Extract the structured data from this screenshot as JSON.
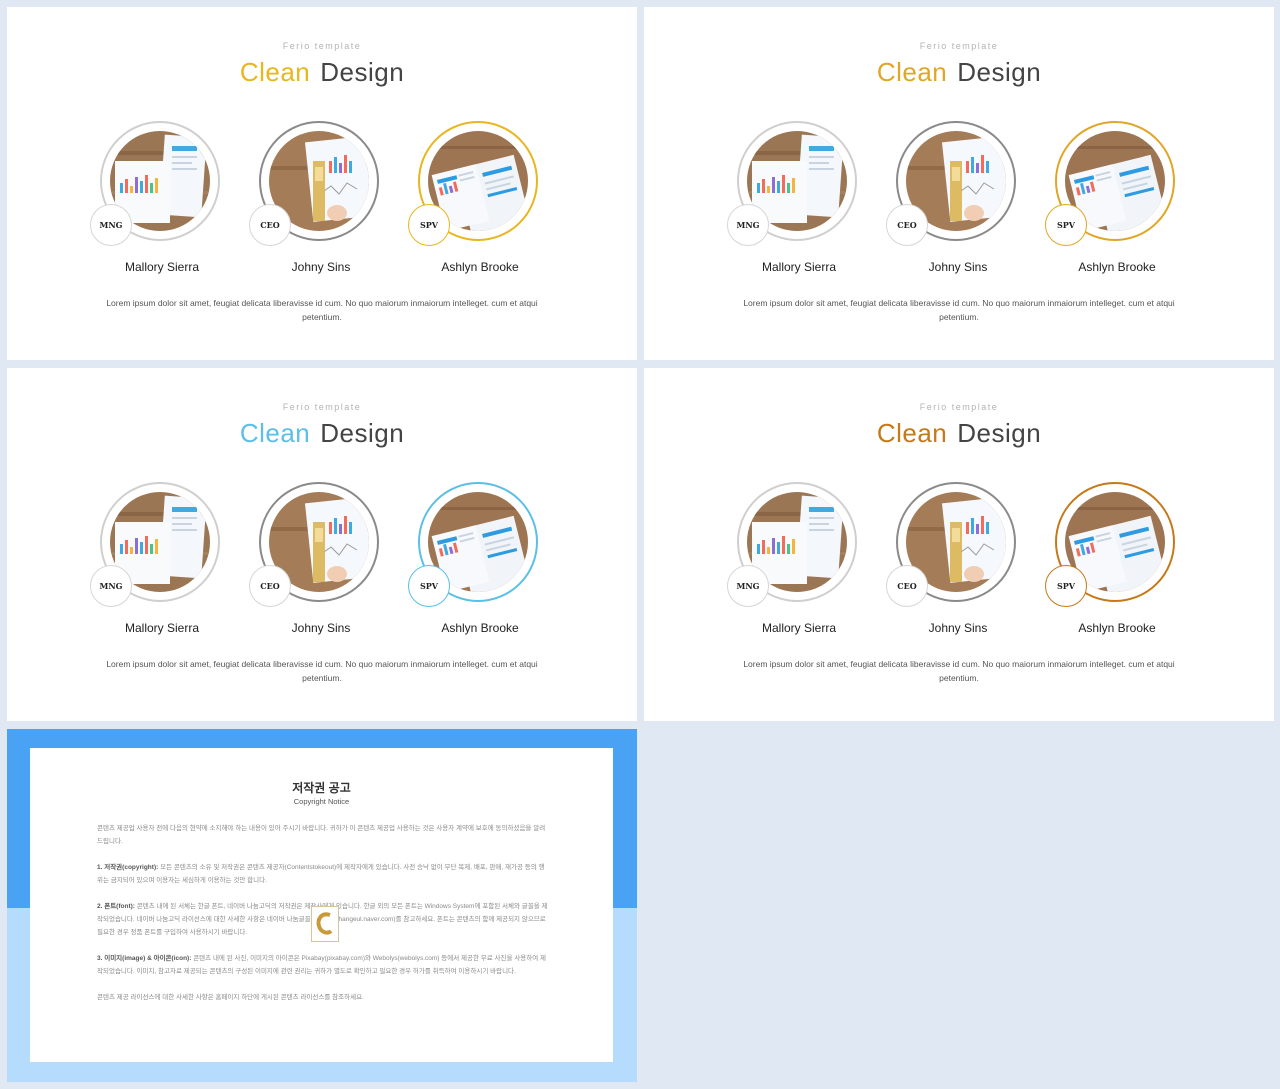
{
  "slides": [
    {
      "subtitle": "Ferio template",
      "title_accent": "Clean",
      "title_rest": "Design",
      "accent_color": "#e8b61e",
      "members": [
        {
          "role": "MNG",
          "name": "Mallory Sierra",
          "ring_color": "#cfcfcf"
        },
        {
          "role": "CEO",
          "name": "Johny Sins",
          "ring_color": "#8a8a8a"
        },
        {
          "role": "SPV",
          "name": "Ashlyn Brooke",
          "ring_color": "#e8b61e"
        }
      ],
      "description": "Lorem ipsum dolor sit amet, feugiat delicata liberavisse id cum. No quo maiorum inmaiorum intelleget. cum et atqui petentium."
    },
    {
      "subtitle": "Ferio template",
      "title_accent": "Clean",
      "title_rest": "Design",
      "accent_color": "#e0a626",
      "members": [
        {
          "role": "MNG",
          "name": "Mallory Sierra",
          "ring_color": "#cfcfcf"
        },
        {
          "role": "CEO",
          "name": "Johny Sins",
          "ring_color": "#8a8a8a"
        },
        {
          "role": "SPV",
          "name": "Ashlyn Brooke",
          "ring_color": "#e0a626"
        }
      ],
      "description": "Lorem ipsum dolor sit amet, feugiat delicata liberavisse id cum. No quo maiorum inmaiorum intelleget. cum et atqui petentium."
    },
    {
      "subtitle": "Ferio template",
      "title_accent": "Clean",
      "title_rest": "Design",
      "accent_color": "#5bbfe8",
      "members": [
        {
          "role": "MNG",
          "name": "Mallory Sierra",
          "ring_color": "#cfcfcf"
        },
        {
          "role": "CEO",
          "name": "Johny Sins",
          "ring_color": "#8a8a8a"
        },
        {
          "role": "SPV",
          "name": "Ashlyn Brooke",
          "ring_color": "#5bbfe8"
        }
      ],
      "description": "Lorem ipsum dolor sit amet, feugiat delicata liberavisse id cum. No quo maiorum inmaiorum intelleget. cum et atqui petentium."
    },
    {
      "subtitle": "Ferio template",
      "title_accent": "Clean",
      "title_rest": "Design",
      "accent_color": "#c57a17",
      "members": [
        {
          "role": "MNG",
          "name": "Mallory Sierra",
          "ring_color": "#cfcfcf"
        },
        {
          "role": "CEO",
          "name": "Johny Sins",
          "ring_color": "#8a8a8a"
        },
        {
          "role": "SPV",
          "name": "Ashlyn Brooke",
          "ring_color": "#c57a17"
        }
      ],
      "description": "Lorem ipsum dolor sit amet, feugiat delicata liberavisse id cum. No quo maiorum inmaiorum intelleget. cum et atqui petentium."
    }
  ],
  "notice": {
    "title": "저작권 공고",
    "subtitle": "Copyright Notice",
    "intro": "콘텐츠 제공업 사용자 전에 다음의 현약에 소지해야 하는 내용이 있어 주시기 바랍니다. 귀하가 이 콘텐츠 제공업 사용하는 것은 사용자 계약에 보호에 동의하셨음을 알려드립니다.",
    "sections": [
      {
        "heading": "1. 저작권(copyright):",
        "text": "모든 콘텐츠의 소유 및 저작권은 콘텐츠 제공자(Contentstokeout)에 제작자에게 있습니다. 사전 승낙 없이 무단 복제, 배포, 판매, 재가공 등의 행위는 금지되어 있으며 이용자는 세심하게 이용하는 것만 합니다."
      },
      {
        "heading": "2. 폰트(font):",
        "text": "콘텐츠 내에 된 서체는 한글 폰트, 네이버 나눔고딕의 저작권은 제작사에게 있습니다. 한글 외의 모든 폰트는 Windows System에 포함된 서체와 글꼴을 제작되었습니다. 네이버 나눔고딕 라이선스에 대한 사세한 사항은 네이버 나눔글꼴 홈페이지(hangeul.naver.com)를 참고하세요. 폰트는 콘텐츠의 함께 제공되지 않으므로 필요한 경우 정품 폰트를 구입하여 사용하시기 바랍니다."
      },
      {
        "heading": "3. 이미지(image) & 아이콘(icon):",
        "text": "콘텐츠 내에 된 사진, 이미지의 아이콘은 Pixabay(pixabay.com)와 Webolys(webolys.com) 등에서 제공한 무료 사진을 사용하여 제작되었습니다. 이미지, 참고자료 제공되는 콘텐츠의 구성된 이미지에 관련 권리는 귀하가 별도로 확인하고 필요한 경우 허가를 취득하여 이용하시기 바랍니다."
      }
    ],
    "footer": "콘텐츠 제공 라이선스에 대한 사세한 사항은 홈페이지 하단에 게시된 콘텐츠 라이선스를 참조하세요."
  }
}
